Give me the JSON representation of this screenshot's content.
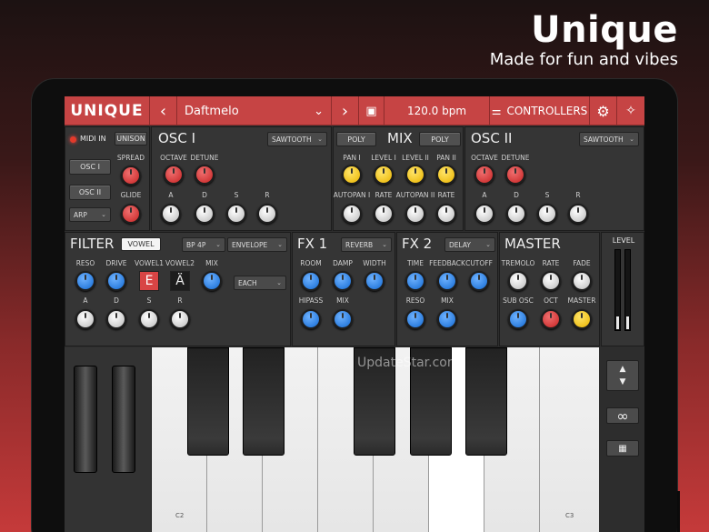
{
  "promo": {
    "title": "Unique",
    "subtitle": "Made for fun and vibes"
  },
  "topbar": {
    "logo": "UNIQUE",
    "prev": "‹",
    "preset": "Daftmelo",
    "preset_caret": "⌄",
    "next": "›",
    "tempo": "120.0 bpm",
    "controllers": "CONTROLLERS",
    "sliders_icon": "⚌",
    "save_icon": "▣",
    "gear_icon": "⚙",
    "midi_icon": "✧"
  },
  "global": {
    "midi_in": "MIDI IN",
    "unison": "UNISON",
    "osc_i": "OSC I",
    "osc_ii": "OSC II",
    "arp": "ARP",
    "spread": "SPREAD",
    "glide": "GLIDE"
  },
  "osc1": {
    "title": "OSC I",
    "wave": "SAWTOOTH",
    "octave": "OCTAVE",
    "detune": "DETUNE",
    "a": "A",
    "d": "D",
    "s": "S",
    "r": "R"
  },
  "mix": {
    "title": "MIX",
    "poly_left": "POLY",
    "poly_right": "POLY",
    "pan1": "PAN I",
    "level1": "LEVEL I",
    "level2": "LEVEL II",
    "pan2": "PAN II",
    "autopan1": "AUTOPAN I",
    "rate1": "RATE",
    "autopan2": "AUTOPAN II",
    "rate2": "RATE"
  },
  "osc2": {
    "title": "OSC II",
    "wave": "SAWTOOTH",
    "octave": "OCTAVE",
    "detune": "DETUNE",
    "a": "A",
    "d": "D",
    "s": "S",
    "r": "R"
  },
  "filter": {
    "title": "FILTER",
    "vowel_btn": "VOWEL",
    "type": "BP 4P",
    "mod": "ENVELOPE",
    "reso": "RESO",
    "drive": "DRIVE",
    "vowel1": "VOWEL1",
    "vowel2": "VOWEL2",
    "mix": "MIX",
    "vowel1_char": "E",
    "vowel2_char": "Ä",
    "each": "EACH",
    "a": "A",
    "d": "D",
    "s": "S",
    "r": "R"
  },
  "fx1": {
    "title": "FX 1",
    "type": "REVERB",
    "room": "ROOM",
    "damp": "DAMP",
    "width": "WIDTH",
    "hipass": "HIPASS",
    "mix": "MIX"
  },
  "fx2": {
    "title": "FX 2",
    "type": "DELAY",
    "time": "TIME",
    "feedback": "FEEDBACK",
    "cutoff": "CUTOFF",
    "reso": "RESO",
    "mix": "MIX"
  },
  "master": {
    "title": "MASTER",
    "tremolo": "TREMOLO",
    "rate": "RATE",
    "fade": "FADE",
    "sub_osc": "SUB OSC",
    "oct": "OCT",
    "master": "MASTER",
    "level": "LEVEL"
  },
  "keyboard": {
    "c2": "C2",
    "c3": "C3"
  },
  "right_controls": {
    "up": "▲",
    "down": "▼",
    "loop": "∞",
    "keys": "▦"
  },
  "watermark": "UpdateStar.com"
}
